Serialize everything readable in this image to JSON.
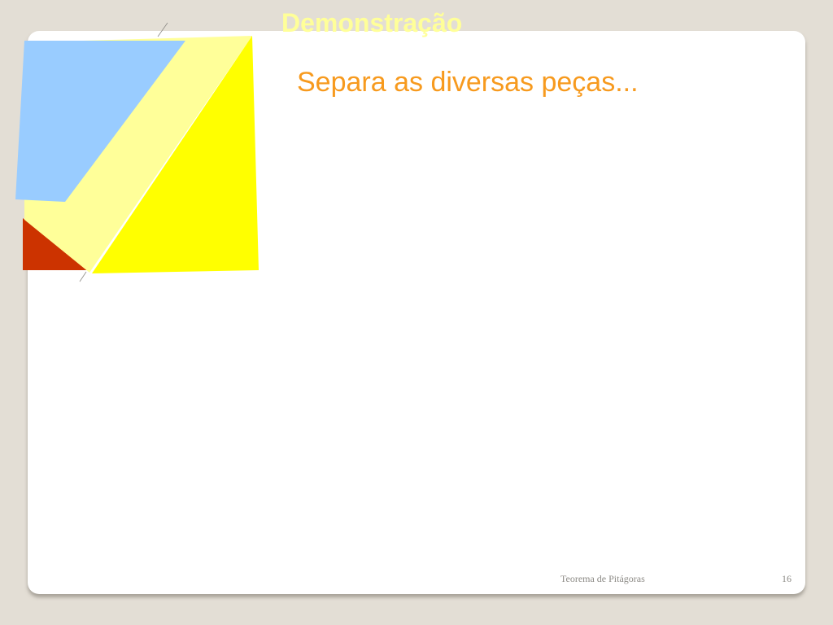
{
  "slide": {
    "title": "Demonstração",
    "subtitle": "Separa as diversas peças...",
    "footer": "Teorema de Pitágoras",
    "page_number": "16"
  },
  "colors": {
    "background": "#e3ded5",
    "card": "#ffffff",
    "title": "#ffff99",
    "subtitle": "#f79a1e",
    "piece_blue": "#99ccff",
    "piece_pale_yellow": "#ffff99",
    "piece_yellow": "#ffff00",
    "piece_red": "#cc3300"
  }
}
